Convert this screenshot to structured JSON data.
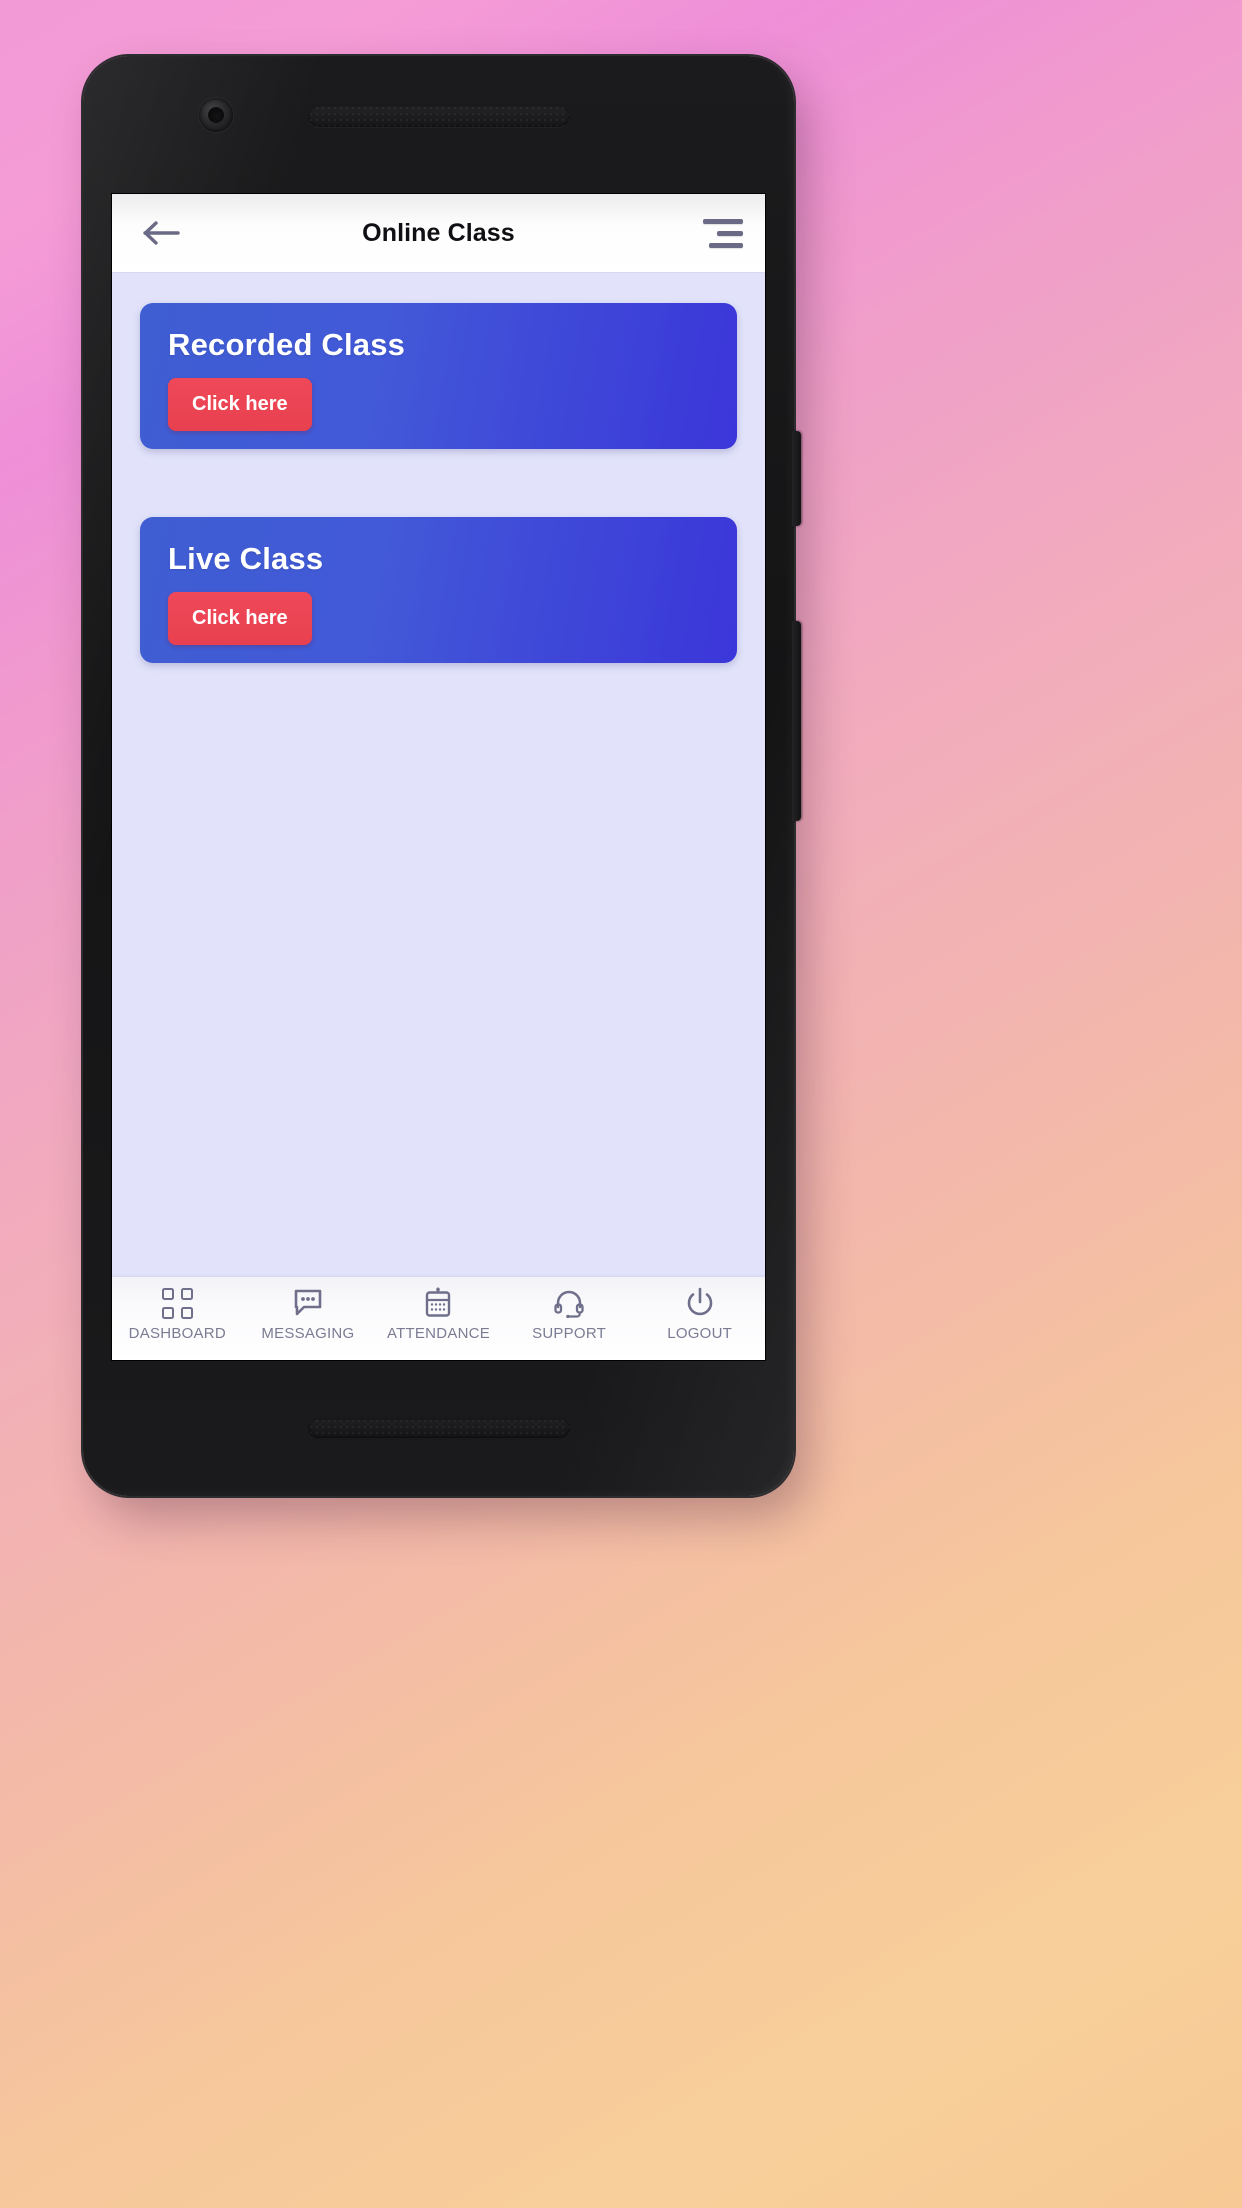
{
  "app": {
    "header": {
      "back_icon": "arrow-left-icon",
      "title": "Online Class",
      "menu_icon": "hamburger-menu-icon"
    },
    "cards": [
      {
        "title": "Recorded Class",
        "button_label": "Click here",
        "accent_color": "#e8404f",
        "card_gradient_from": "#3f5ed2",
        "card_gradient_to": "#3b36d9"
      },
      {
        "title": "Live Class",
        "button_label": "Click here",
        "accent_color": "#e8404f",
        "card_gradient_from": "#3f5ed2",
        "card_gradient_to": "#3b36d9"
      }
    ],
    "bottom_nav": [
      {
        "label": "DASHBOARD",
        "icon": "grid-icon"
      },
      {
        "label": "MESSAGING",
        "icon": "chat-bubble-icon"
      },
      {
        "label": "ATTENDANCE",
        "icon": "calendar-device-icon"
      },
      {
        "label": "SUPPORT",
        "icon": "headset-icon"
      },
      {
        "label": "LOGOUT",
        "icon": "power-icon"
      }
    ],
    "colors": {
      "screen_background": "#e2e3fa",
      "app_bar_background": "#ffffff",
      "nav_label": "#7b7b93",
      "icon_stroke": "#6f6f8c"
    }
  },
  "device": {
    "frame_color": "#171719",
    "hardware": {
      "front_camera": "front-camera",
      "earpiece_speaker": "earpiece-speaker-grille",
      "bottom_speaker": "bottom-speaker-grille",
      "power_button": "power-side-button",
      "volume_button": "volume-side-button"
    }
  },
  "background": {
    "gradient_from": "#f19ad6",
    "gradient_to": "#f7c994"
  }
}
